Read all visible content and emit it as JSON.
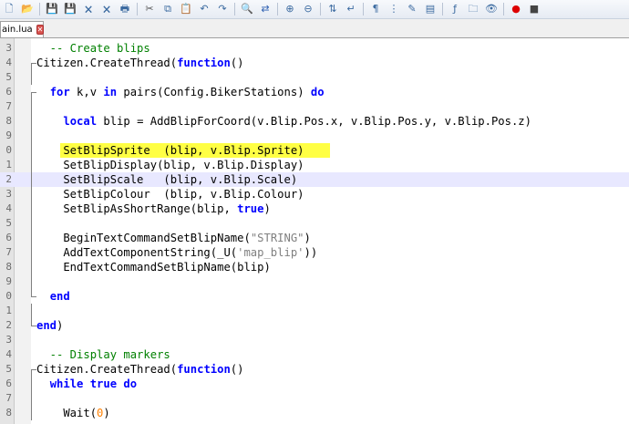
{
  "toolbar": {
    "icons": [
      "new-file",
      "open-file",
      "save",
      "save-all",
      "close",
      "close-all",
      "print",
      "cut",
      "copy",
      "paste",
      "undo",
      "redo",
      "find",
      "replace",
      "zoom-in",
      "zoom-out",
      "sync-scroll",
      "word-wrap",
      "show-all-chars",
      "indent-guide",
      "udl",
      "doc-map",
      "function-list",
      "folder-as-workspace",
      "monitor",
      "record-macro",
      "stop-macro"
    ]
  },
  "tab": {
    "label": "ain.lua"
  },
  "editor": {
    "lines": [
      {
        "num": "3",
        "tokens": [
          [
            "  -- Create blips",
            "cm"
          ]
        ]
      },
      {
        "num": "4",
        "tokens": [
          [
            "Citizen.CreateThread(",
            ""
          ],
          [
            "function",
            "kw"
          ],
          [
            "()",
            ""
          ]
        ]
      },
      {
        "num": "5",
        "tokens": []
      },
      {
        "num": "6",
        "tokens": [
          [
            "  ",
            ""
          ],
          [
            "for",
            "kw"
          ],
          [
            " k,v ",
            ""
          ],
          [
            "in",
            "kw"
          ],
          [
            " pairs(Config.BikerStations) ",
            ""
          ],
          [
            "do",
            "kw"
          ]
        ]
      },
      {
        "num": "7",
        "tokens": []
      },
      {
        "num": "8",
        "tokens": [
          [
            "    ",
            ""
          ],
          [
            "local",
            "kw"
          ],
          [
            " blip = AddBlipForCoord(v.Blip.Pos.x, v.Blip.Pos.y, v.Blip.Pos.z)",
            ""
          ]
        ]
      },
      {
        "num": "9",
        "tokens": []
      },
      {
        "num": "0",
        "tokens": [
          [
            "    SetBlipSprite  (blip, v.Blip.Sprite)",
            ""
          ]
        ]
      },
      {
        "num": "1",
        "tokens": [
          [
            "    SetBlipDisplay(blip, v.Blip.Display)",
            ""
          ]
        ]
      },
      {
        "num": "2",
        "tokens": [
          [
            "    SetBlipScale   (blip, v.Blip.Scale)",
            ""
          ]
        ]
      },
      {
        "num": "3",
        "tokens": [
          [
            "    SetBlipColour  (blip, v.Blip.Colour)",
            ""
          ]
        ]
      },
      {
        "num": "4",
        "tokens": [
          [
            "    SetBlipAsShortRange(blip, ",
            ""
          ],
          [
            "true",
            "kw"
          ],
          [
            ")",
            ""
          ]
        ]
      },
      {
        "num": "5",
        "tokens": []
      },
      {
        "num": "6",
        "tokens": [
          [
            "    BeginTextCommandSetBlipName(",
            ""
          ],
          [
            "\"STRING\"",
            "st"
          ],
          [
            ")",
            ""
          ]
        ]
      },
      {
        "num": "7",
        "tokens": [
          [
            "    AddTextComponentString(_U(",
            ""
          ],
          [
            "'map_blip'",
            "st"
          ],
          [
            "))",
            ""
          ]
        ]
      },
      {
        "num": "8",
        "tokens": [
          [
            "    EndTextCommandSetBlipName(blip)",
            ""
          ]
        ]
      },
      {
        "num": "9",
        "tokens": []
      },
      {
        "num": "0",
        "tokens": [
          [
            "  ",
            ""
          ],
          [
            "end",
            "kw"
          ]
        ]
      },
      {
        "num": "1",
        "tokens": []
      },
      {
        "num": "2",
        "tokens": [
          [
            "end",
            "kw"
          ],
          [
            ")",
            ""
          ]
        ]
      },
      {
        "num": "3",
        "tokens": []
      },
      {
        "num": "4",
        "tokens": [
          [
            "  -- Display markers",
            "cm"
          ]
        ]
      },
      {
        "num": "5",
        "tokens": [
          [
            "Citizen.CreateThread(",
            ""
          ],
          [
            "function",
            "kw"
          ],
          [
            "()",
            ""
          ]
        ]
      },
      {
        "num": "6",
        "tokens": [
          [
            "  ",
            ""
          ],
          [
            "while",
            "kw"
          ],
          [
            " ",
            ""
          ],
          [
            "true",
            "kw"
          ],
          [
            " ",
            ""
          ],
          [
            "do",
            "kw"
          ]
        ]
      },
      {
        "num": "7",
        "tokens": []
      },
      {
        "num": "8",
        "tokens": [
          [
            "    Wait(",
            ""
          ],
          [
            "0",
            "nm"
          ],
          [
            ")",
            ""
          ]
        ]
      }
    ],
    "highlighted_line_index": 7,
    "current_line_index": 9,
    "colors": {
      "keyword": "#0000ff",
      "comment": "#008000",
      "string": "#808080",
      "number": "#ff8000",
      "highlight": "#ffff44",
      "current_line": "#e8e8ff"
    }
  }
}
